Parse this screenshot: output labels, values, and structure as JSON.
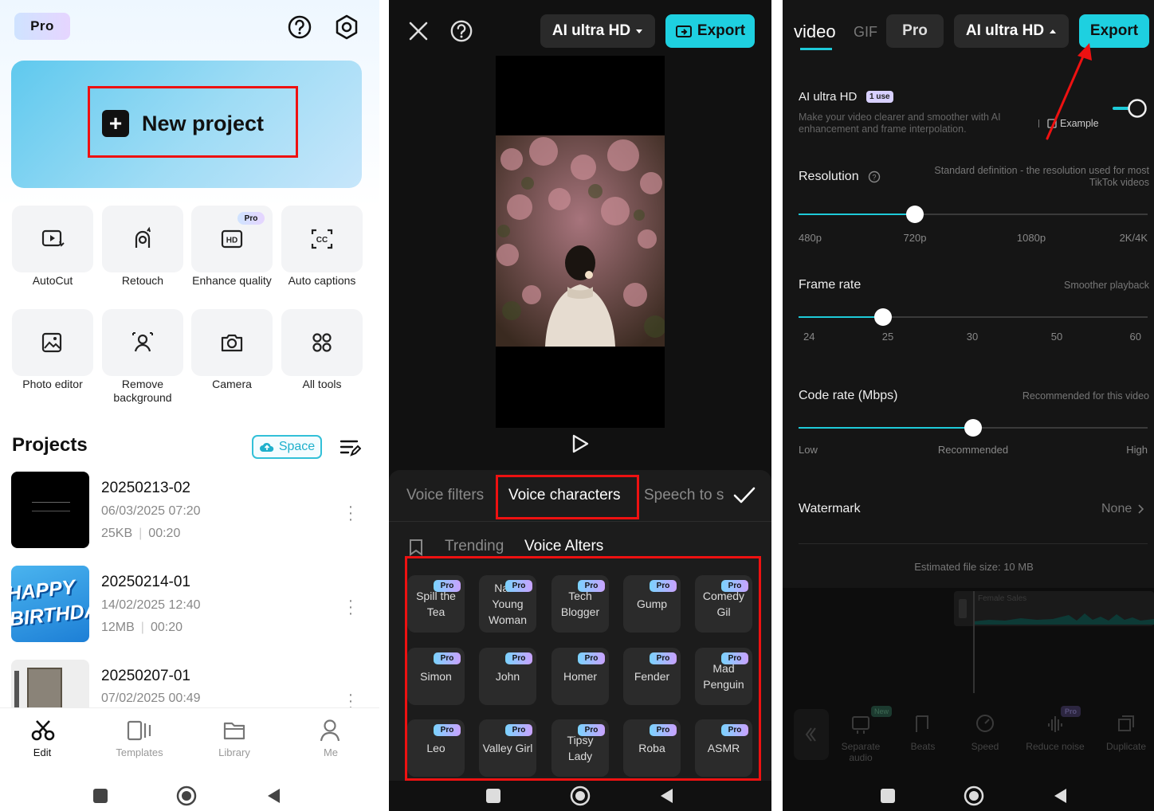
{
  "panel1": {
    "pro_badge": "Pro",
    "new_project": "New project",
    "tools": [
      {
        "label": "AutoCut",
        "icon": "autocut-icon"
      },
      {
        "label": "Retouch",
        "icon": "retouch-icon"
      },
      {
        "label": "Enhance quality",
        "icon": "hd-icon",
        "badge": "Pro"
      },
      {
        "label": "Auto captions",
        "icon": "captions-icon"
      },
      {
        "label": "Photo editor",
        "icon": "photo-editor-icon"
      },
      {
        "label": "Remove background",
        "icon": "remove-bg-icon"
      },
      {
        "label": "Camera",
        "icon": "camera-icon"
      },
      {
        "label": "All tools",
        "icon": "grid-icon"
      }
    ],
    "projects_title": "Projects",
    "space_label": "Space",
    "projects": [
      {
        "name": "20250213-02",
        "date": "06/03/2025 07:20",
        "size": "25KB",
        "duration": "00:20"
      },
      {
        "name": "20250214-01",
        "date": "14/02/2025 12:40",
        "size": "12MB",
        "duration": "00:20",
        "thumb_text": "HAPPY BIRTHDA"
      },
      {
        "name": "20250207-01",
        "date": "07/02/2025 00:49"
      }
    ],
    "nav": [
      "Edit",
      "Templates",
      "Library",
      "Me"
    ]
  },
  "panel2": {
    "hd_label": "AI ultra HD",
    "export_label": "Export",
    "tabs": [
      "Voice filters",
      "Voice characters",
      "Speech to s"
    ],
    "sub_tabs": [
      "Trending",
      "Voice Alters"
    ],
    "voices": [
      [
        "Spill the Tea",
        "Nana Young Woman",
        "Tech Blogger",
        "Gump",
        "Comedy Gil"
      ],
      [
        "Simon",
        "John",
        "Homer",
        "Fender",
        "Mad Penguin"
      ],
      [
        "Leo",
        "Valley Girl",
        "Tipsy Lady",
        "Roba",
        "ASMR"
      ]
    ],
    "cell_badge": "Pro"
  },
  "panel3": {
    "tabs": [
      "video",
      "GIF"
    ],
    "pro_label": "Pro",
    "hd_label": "AI ultra HD",
    "export_label": "Export",
    "ai_hd_title": "AI ultra HD",
    "ai_hd_badge": "1 use",
    "ai_hd_desc": "Make your video clearer and smoother with AI enhancement and frame interpolation.",
    "example": "Example",
    "resolution_label": "Resolution",
    "resolution_hint": "Standard definition - the resolution used for most TikTok videos",
    "resolution_ticks": [
      "480p",
      "720p",
      "1080p",
      "2K/4K"
    ],
    "resolution_value": "720p",
    "framerate_label": "Frame rate",
    "framerate_hint": "Smoother playback",
    "framerate_ticks": [
      "24",
      "25",
      "30",
      "50",
      "60"
    ],
    "framerate_value": "25",
    "coderate_label": "Code rate (Mbps)",
    "coderate_hint": "Recommended for this video",
    "coderate_ticks": [
      "Low",
      "Recommended",
      "High"
    ],
    "coderate_value": "Recommended",
    "watermark_label": "Watermark",
    "watermark_value": "None",
    "estimated": "Estimated file size: 10 MB",
    "timeline_tools": [
      "Separate audio",
      "Beats",
      "Speed",
      "Reduce noise",
      "Duplicate"
    ],
    "timeline_badge_new": "New",
    "timeline_badge_pro": "Pro",
    "audio_track_label": "Female Sales"
  },
  "colors": {
    "accent": "#1ed0e0",
    "highlight": "#ee1111"
  }
}
